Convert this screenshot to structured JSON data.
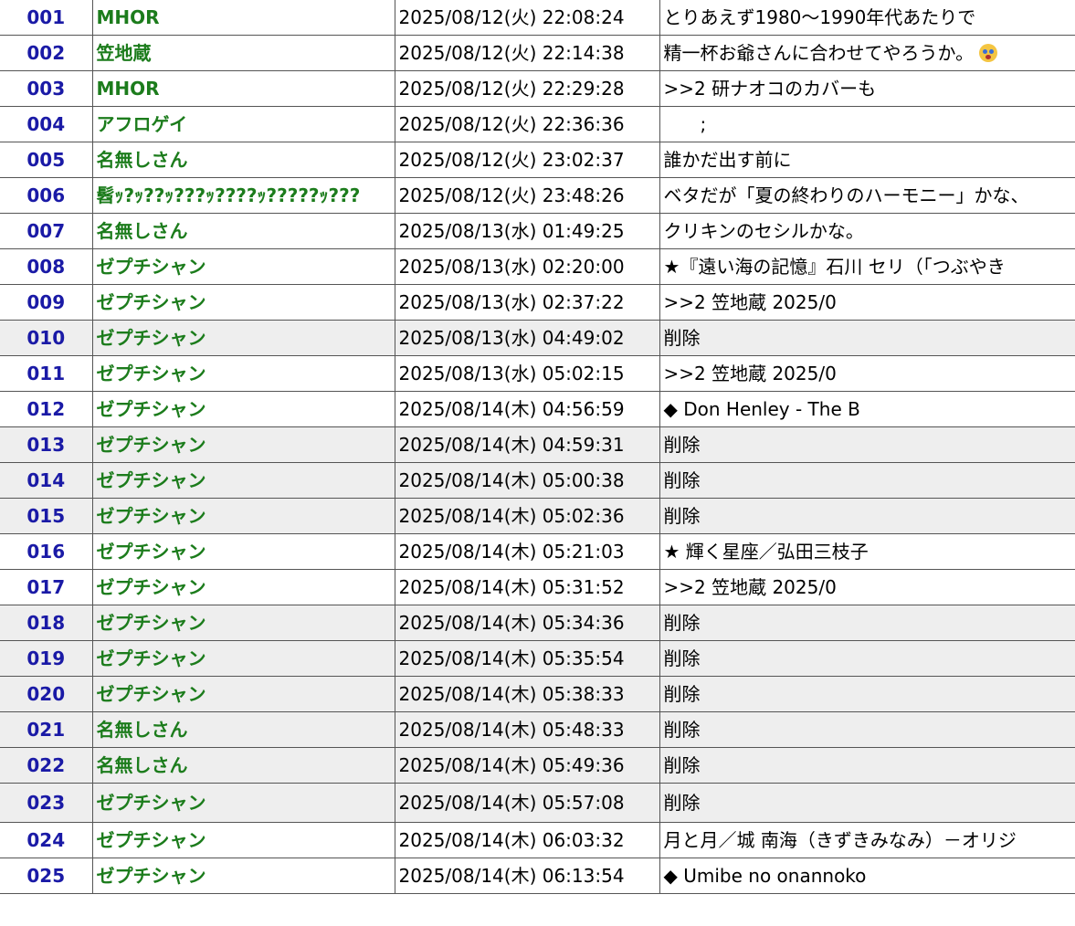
{
  "rows": [
    {
      "num": "001",
      "name": "MHOR",
      "date": "2025/08/12(火) 22:08:24",
      "body": "とりあえず1980～1990年代あたりで",
      "deleted": false
    },
    {
      "num": "002",
      "name": "笠地蔵",
      "date": "2025/08/12(火) 22:14:38",
      "body": "精一杯お爺さんに合わせてやろうか。",
      "icon": "screaming-face-emoji-icon",
      "deleted": false
    },
    {
      "num": "003",
      "name": "MHOR",
      "date": "2025/08/12(火) 22:29:28",
      "body": ">>2 研ナオコのカバーも",
      "deleted": false
    },
    {
      "num": "004",
      "name": "アフロゲイ",
      "date": "2025/08/12(火) 22:36:36",
      "body": "　　;",
      "deleted": false
    },
    {
      "num": "005",
      "name": "名無しさん",
      "date": "2025/08/12(火) 23:02:37",
      "body": "誰かだ出す前に",
      "deleted": false
    },
    {
      "num": "006",
      "name": "髫ｯ?ｯ??ｯ???ｯ????ｯ?????ｯ???",
      "date": "2025/08/12(火) 23:48:26",
      "body": "ベタだが「夏の終わりのハーモニー」かな、",
      "deleted": false
    },
    {
      "num": "007",
      "name": "名無しさん",
      "date": "2025/08/13(水) 01:49:25",
      "body": "クリキンのセシルかな。",
      "deleted": false
    },
    {
      "num": "008",
      "name": "ゼプチシャン",
      "date": "2025/08/13(水) 02:20:00",
      "body": "★『遠い海の記憶』石川 セリ（「つぶやき",
      "deleted": false
    },
    {
      "num": "009",
      "name": "ゼプチシャン",
      "date": "2025/08/13(水) 02:37:22",
      "body": ">>2 笠地蔵 2025/0",
      "deleted": false
    },
    {
      "num": "010",
      "name": "ゼプチシャン",
      "date": "2025/08/13(水) 04:49:02",
      "body": "削除",
      "deleted": true
    },
    {
      "num": "011",
      "name": "ゼプチシャン",
      "date": "2025/08/13(水) 05:02:15",
      "body": ">>2 笠地蔵 2025/0",
      "deleted": false
    },
    {
      "num": "012",
      "name": "ゼプチシャン",
      "date": "2025/08/14(木) 04:56:59",
      "body": "◆ Don Henley - The B",
      "deleted": false
    },
    {
      "num": "013",
      "name": "ゼプチシャン",
      "date": "2025/08/14(木) 04:59:31",
      "body": "削除",
      "deleted": true
    },
    {
      "num": "014",
      "name": "ゼプチシャン",
      "date": "2025/08/14(木) 05:00:38",
      "body": "削除",
      "deleted": true
    },
    {
      "num": "015",
      "name": "ゼプチシャン",
      "date": "2025/08/14(木) 05:02:36",
      "body": "削除",
      "deleted": true
    },
    {
      "num": "016",
      "name": "ゼプチシャン",
      "date": "2025/08/14(木) 05:21:03",
      "body": "★ 輝く星座／弘田三枝子",
      "deleted": false
    },
    {
      "num": "017",
      "name": "ゼプチシャン",
      "date": "2025/08/14(木) 05:31:52",
      "body": ">>2 笠地蔵 2025/0",
      "deleted": false
    },
    {
      "num": "018",
      "name": "ゼプチシャン",
      "date": "2025/08/14(木) 05:34:36",
      "body": "削除",
      "deleted": true
    },
    {
      "num": "019",
      "name": "ゼプチシャン",
      "date": "2025/08/14(木) 05:35:54",
      "body": "削除",
      "deleted": true
    },
    {
      "num": "020",
      "name": "ゼプチシャン",
      "date": "2025/08/14(木) 05:38:33",
      "body": "削除",
      "deleted": true
    },
    {
      "num": "021",
      "name": "名無しさん",
      "date": "2025/08/14(木) 05:48:33",
      "body": "削除",
      "deleted": true
    },
    {
      "num": "022",
      "name": "名無しさん",
      "date": "2025/08/14(木) 05:49:36",
      "body": "削除",
      "deleted": true
    },
    {
      "num": "023",
      "name": "ゼプチシャン",
      "date": "2025/08/14(木) 05:57:08",
      "body": "削除",
      "deleted": true
    },
    {
      "num": "024",
      "name": "ゼプチシャン",
      "date": "2025/08/14(木) 06:03:32",
      "body": "月と月／城 南海（きずきみなみ）－オリジ",
      "deleted": false
    },
    {
      "num": "025",
      "name": "ゼプチシャン",
      "date": "2025/08/14(木) 06:13:54",
      "body": "◆ Umibe no onannoko",
      "deleted": false
    }
  ]
}
